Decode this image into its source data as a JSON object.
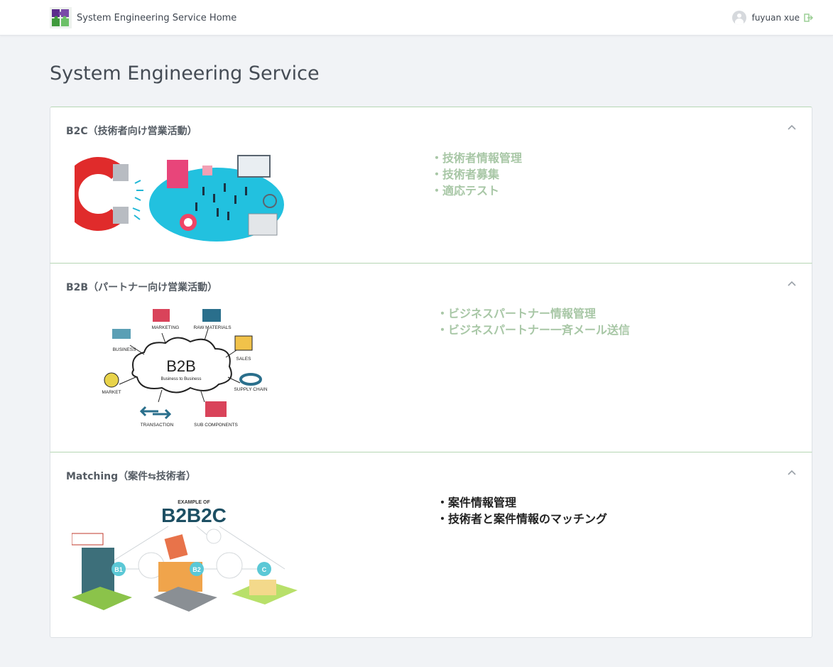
{
  "header": {
    "brand_title": "System Engineering Service Home",
    "user_name": "fuyuan xue",
    "icons": [
      "puzzle-logo-icon",
      "user-avatar-icon",
      "logout-icon"
    ]
  },
  "page": {
    "title": "System Engineering Service"
  },
  "panels": [
    {
      "title": "B2C（技術者向け営業活動）",
      "features": [
        "技術者情報管理",
        "技術者募集",
        "適応テスト"
      ],
      "image_alt": "magnet attracting people"
    },
    {
      "title": "B2B（パートナー向け営業活動）",
      "features": [
        "ビジネスパートナー情報管理",
        "ビジネスパートナー一斉メール送信"
      ],
      "image": {
        "center": "B2B",
        "center_sub": "Business to Business",
        "labels": [
          "MARKETING",
          "RAW MATERIALS",
          "BUSINESS",
          "SALES",
          "MARKET",
          "SUPPLY CHAIN",
          "TRANSACTION",
          "SUB COMPONENTS"
        ]
      }
    },
    {
      "title": "Matching（案件⇆技術者）",
      "features": [
        "案件情報管理",
        "技術者と案件情報のマッチング"
      ],
      "image": {
        "caption": "EXAMPLE OF",
        "headline": "B2B2C",
        "nodes": [
          "B1",
          "B2",
          "C"
        ]
      }
    }
  ],
  "colors": {
    "feature_green": "#a8c7a6",
    "panel_border_accent": "#b5d6b3",
    "background": "#f1f3f6"
  }
}
